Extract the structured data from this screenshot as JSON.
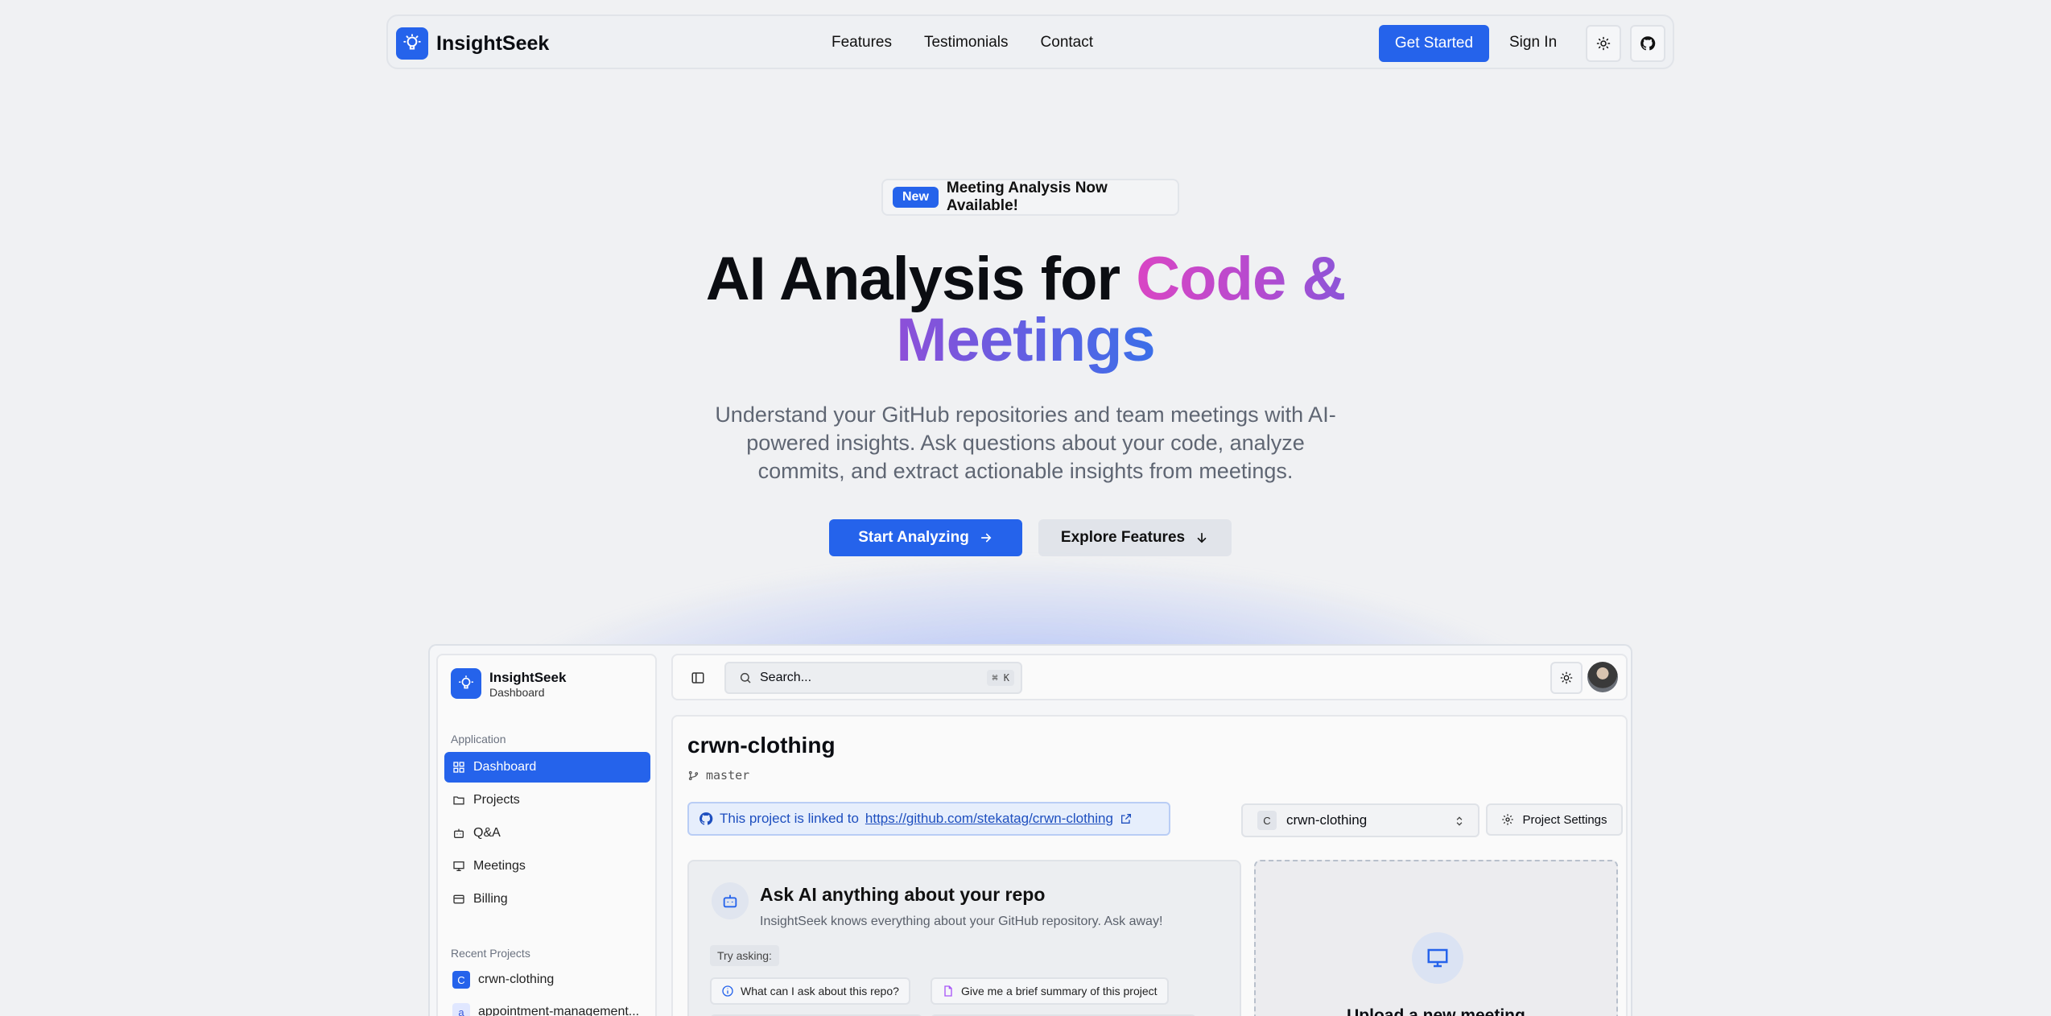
{
  "nav": {
    "brand": "InsightSeek",
    "links": [
      "Features",
      "Testimonials",
      "Contact"
    ],
    "get_started": "Get Started",
    "sign_in": "Sign In"
  },
  "announcement": {
    "badge": "New",
    "text": "Meeting Analysis Now Available!"
  },
  "hero": {
    "title_plain": "AI Analysis for",
    "title_grad1": "Code &",
    "title_grad2": "Meetings",
    "subtitle": "Understand your GitHub repositories and team meetings with AI-powered insights. Ask questions about your code, analyze commits, and extract actionable insights from meetings.",
    "start": "Start Analyzing",
    "explore": "Explore Features"
  },
  "app": {
    "sidebar": {
      "title": "InsightSeek",
      "subtitle": "Dashboard",
      "section_app": "Application",
      "items": [
        "Dashboard",
        "Projects",
        "Q&A",
        "Meetings",
        "Billing"
      ],
      "section_recent": "Recent Projects",
      "recent": [
        {
          "chip": "C",
          "name": "crwn-clothing"
        },
        {
          "chip": "a",
          "name": "appointment-management..."
        }
      ]
    },
    "topbar": {
      "search_placeholder": "Search...",
      "shortcut": "⌘ K"
    },
    "project": {
      "name": "crwn-clothing",
      "branch": "master",
      "link_prefix": "This project is linked to",
      "link_url": "https://github.com/stekatag/crwn-clothing",
      "selector_chip": "C",
      "selector_name": "crwn-clothing",
      "settings": "Project Settings"
    },
    "ask": {
      "title": "Ask AI anything about your repo",
      "subtitle": "InsightSeek knows everything about your GitHub repository. Ask away!",
      "try": "Try asking:",
      "suggestions": [
        "What can I ask about this repo?",
        "Give me a brief summary of this project"
      ]
    },
    "upload": {
      "title": "Upload a new meeting"
    }
  },
  "colors": {
    "primary": "#2563eb",
    "gradient_pink": "#d946c4",
    "gradient_purple": "#8b55d8",
    "gradient_blue": "#3b6fe8"
  }
}
